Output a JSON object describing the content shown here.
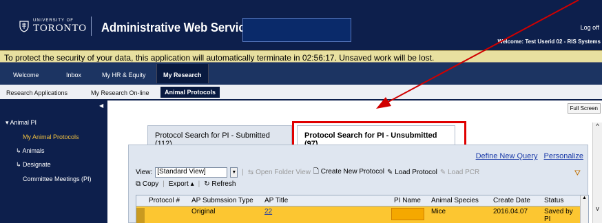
{
  "header": {
    "university_small": "UNIVERSITY OF",
    "university_big": "TORONTO",
    "app_title": "Administrative Web Services",
    "logoff": "Log off",
    "welcome": "Welcome: Test Userid 02 - RIS Systems"
  },
  "timeout_message": "To protect the security of your data, this application will automatically terminate in 02:56:17. Unsaved work will be lost.",
  "nav_primary": [
    "Welcome",
    "Inbox",
    "My HR & Equity",
    "My Research"
  ],
  "nav_secondary": [
    "Research Applications",
    "My Research On-line",
    "Animal Protocols"
  ],
  "sidebar": {
    "section": "Animal PI",
    "items": [
      "My Animal Protocols",
      "Animals",
      "Designate",
      "Committee Meetings (PI)"
    ]
  },
  "fullscreen_label": "Full Screen",
  "tabs": [
    {
      "label": "Protocol Search for PI - Submitted (112)"
    },
    {
      "label": "Protocol Search for PI - Unsubmitted (97)"
    }
  ],
  "links": {
    "define_query": "Define New Query",
    "personalize": "Personalize"
  },
  "toolbar": {
    "view_label": "View:",
    "view_value": "[Standard View]",
    "open_folder": "Open Folder View",
    "create": "Create New Protocol",
    "load_protocol": "Load Protocol",
    "load_pcr": "Load PCR",
    "copy": "Copy",
    "export": "Export",
    "refresh": "Refresh"
  },
  "table": {
    "columns": [
      "Protocol #",
      "AP Submssion Type",
      "AP Title",
      "PI Name",
      "Animal Species",
      "Create Date",
      "Status"
    ],
    "rows": [
      {
        "protocol": "",
        "type": "Original",
        "title": "22",
        "pi": "",
        "species": "Mice",
        "date": "2016.04.07",
        "status": "Saved by PI"
      }
    ]
  },
  "colors": {
    "header_bg": "#0d1f4c",
    "highlight": "#e00000",
    "row_selected": "#fcc631"
  }
}
